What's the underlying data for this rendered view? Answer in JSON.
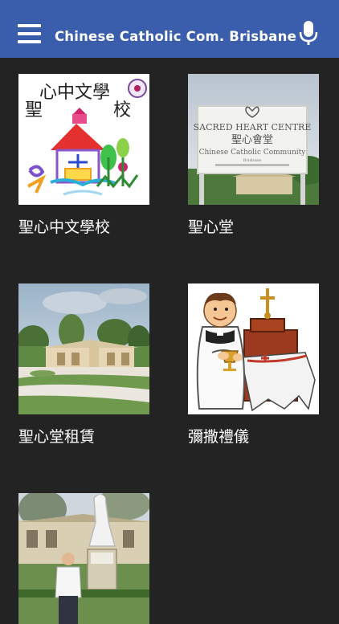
{
  "app_bar": {
    "title": "Chinese Catholic Com. Brisbane",
    "menu_icon": "hamburger-menu-icon",
    "mic_icon": "microphone-icon",
    "background_color": "#3a5eab"
  },
  "grid": {
    "items": [
      {
        "label": "聖心中文學校",
        "image": "school-logo-image",
        "logo_text": "心中文學 聖 校"
      },
      {
        "label": "聖心堂",
        "image": "sacred-heart-centre-sign-image",
        "sign_text": [
          "SACRED HEART CENTRE",
          "聖心會堂",
          "Chinese Catholic Community",
          "Brisbane"
        ]
      },
      {
        "label": "聖心堂租賃",
        "image": "church-building-image"
      },
      {
        "label": "彌撒禮儀",
        "image": "priest-mass-clipart-image"
      },
      {
        "label": "",
        "image": "statue-courtyard-image"
      }
    ]
  }
}
